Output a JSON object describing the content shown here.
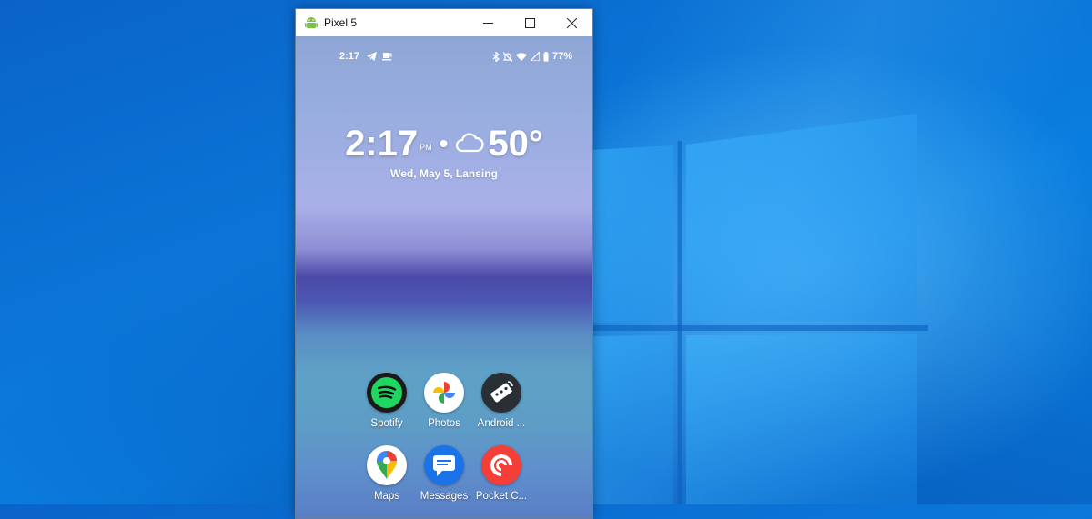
{
  "desktop": {
    "accent": "#0a74d8"
  },
  "window": {
    "title": "Pixel 5",
    "icon": "android-icon",
    "controls": [
      "minimize-icon",
      "maximize-icon",
      "close-icon"
    ]
  },
  "statusbar": {
    "time": "2:17",
    "battery": "77%",
    "left_icons": [
      "telegram-icon",
      "coffee-icon"
    ],
    "right_icons": [
      "bluetooth-icon",
      "mute-icon",
      "wifi-icon",
      "signal-icon",
      "battery-icon"
    ]
  },
  "clock": {
    "time": "2:17",
    "ampm": "PM",
    "separator": "•",
    "temp": "50°",
    "weather_icon": "cloud-icon",
    "date": "Wed, May 5, Lansing"
  },
  "apps": [
    {
      "label": "Spotify",
      "icon": "spotify-icon"
    },
    {
      "label": "Photos",
      "icon": "photos-icon"
    },
    {
      "label": "Android ...",
      "icon": "remote-icon"
    },
    {
      "label": "Maps",
      "icon": "maps-icon"
    },
    {
      "label": "Messages",
      "icon": "messages-icon"
    },
    {
      "label": "Pocket C...",
      "icon": "pocket-casts-icon"
    }
  ]
}
